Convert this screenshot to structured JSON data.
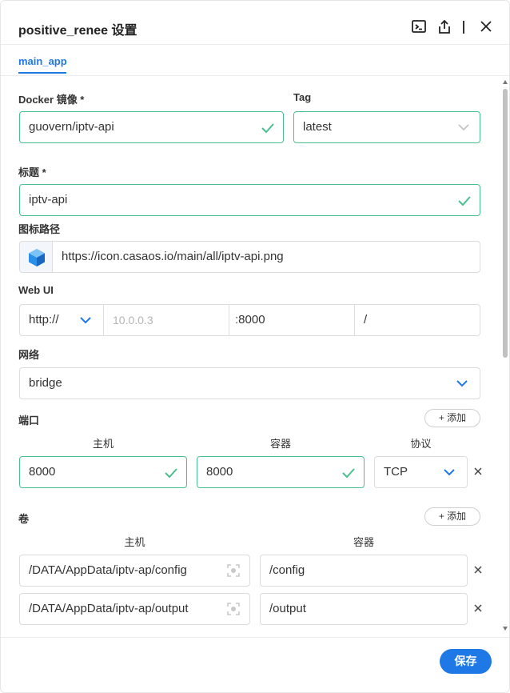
{
  "dialog": {
    "title": "positive_renee 设置"
  },
  "tabs": [
    {
      "label": "main_app"
    }
  ],
  "docker_image": {
    "label": "Docker 镜像 *",
    "value": "guovern/iptv-api"
  },
  "tag": {
    "label": "Tag",
    "value": "latest"
  },
  "title_field": {
    "label": "标题 *",
    "value": "iptv-api"
  },
  "icon_path": {
    "label": "图标路径",
    "value": "https://icon.casaos.io/main/all/iptv-api.png"
  },
  "webui": {
    "label": "Web UI",
    "protocol": "http://",
    "host_placeholder": "10.0.0.3",
    "port_prefix": ":",
    "port": "8000",
    "path": "/"
  },
  "network": {
    "label": "网络",
    "value": "bridge"
  },
  "ports": {
    "label": "端口",
    "add_label": "添加",
    "col_host": "主机",
    "col_container": "容器",
    "col_protocol": "协议",
    "rows": [
      {
        "host": "8000",
        "container": "8000",
        "protocol": "TCP"
      }
    ]
  },
  "volumes": {
    "label": "卷",
    "add_label": "添加",
    "col_host": "主机",
    "col_container": "容器",
    "rows": [
      {
        "host": "/DATA/AppData/iptv-ap/config",
        "container": "/config"
      },
      {
        "host": "/DATA/AppData/iptv-ap/output",
        "container": "/output"
      }
    ]
  },
  "footer": {
    "save_label": "保存"
  },
  "colors": {
    "accent": "#1e78e6",
    "valid": "#4cbf8f"
  },
  "icons": [
    "terminal-icon",
    "share-icon",
    "close-icon",
    "check-icon",
    "chevron-down-icon",
    "cube-icon",
    "plus-icon",
    "remove-icon",
    "folder-select-icon"
  ]
}
